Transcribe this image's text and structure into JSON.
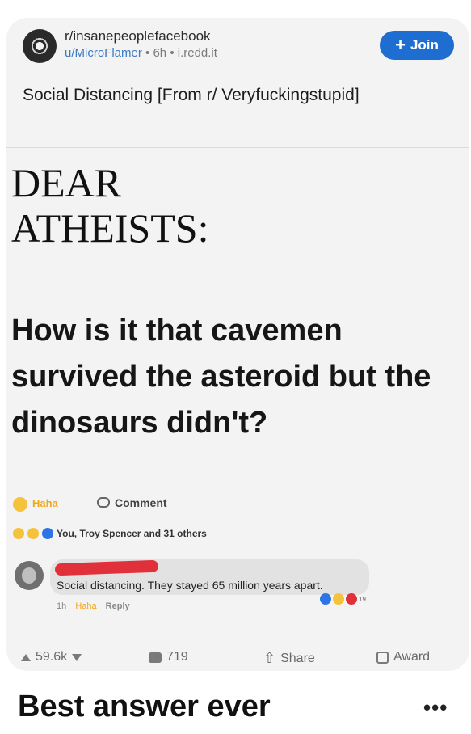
{
  "post": {
    "subreddit": "r/insanepeoplefacebook",
    "user": "u/MicroFlamer",
    "age": "6h",
    "domain": "i.redd.it",
    "join_label": "Join",
    "title": "Social Distancing [From r/ Veryfuckingstupid]"
  },
  "meme": {
    "line1": "DEAR",
    "line2": "ATHEISTS:",
    "question": "How is it that cavemen survived the asteroid but the dinosaurs didn't?",
    "fb_haha": "Haha",
    "fb_comment": "Comment",
    "reactors": "You, Troy Spencer and 31 others",
    "comment_text": "Social distancing. They stayed 65 million years apart.",
    "comment_time": "1h",
    "comment_haha": "Haha",
    "comment_reply": "Reply",
    "comment_reaction_count": "19"
  },
  "stats": {
    "upvotes": "59.6k",
    "comments": "719",
    "share": "Share",
    "award": "Award"
  },
  "caption": "Best answer ever",
  "more": "•••",
  "colors": {
    "accent": "#1e6ed1",
    "haha": "#f0a71a",
    "redact": "#e0303a"
  }
}
